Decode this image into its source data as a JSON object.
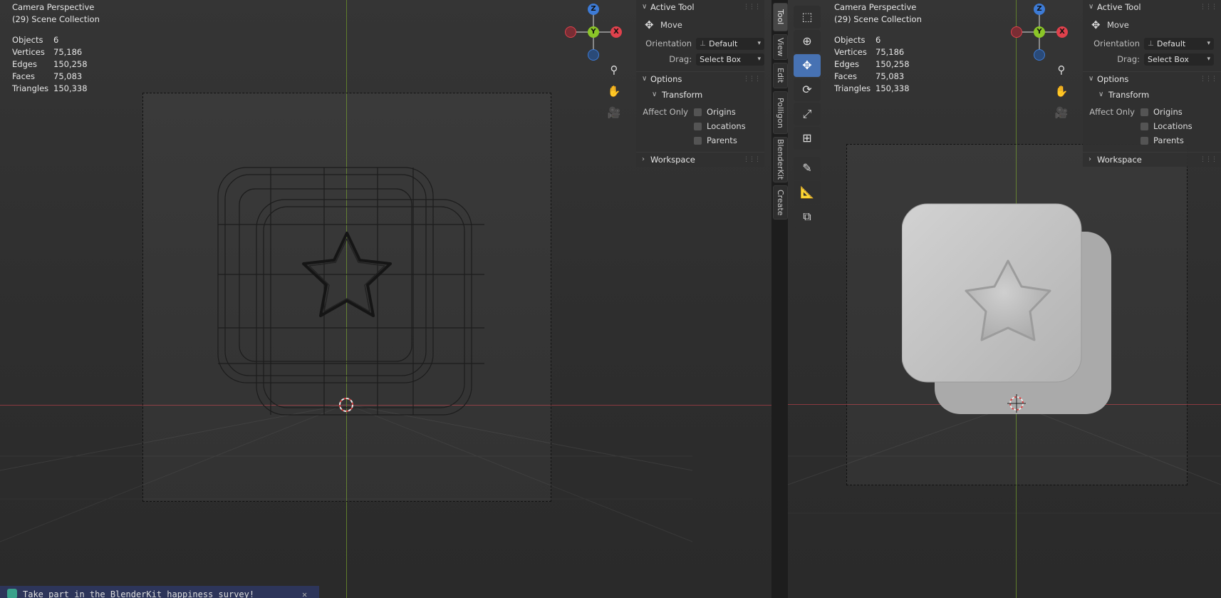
{
  "viewports": [
    {
      "id": "left",
      "mode": "wireframe",
      "info": {
        "line1": "Camera Perspective",
        "line2": "(29) Scene Collection"
      },
      "stats": [
        {
          "label": "Objects",
          "value": "6"
        },
        {
          "label": "Vertices",
          "value": "75,186"
        },
        {
          "label": "Edges",
          "value": "150,258"
        },
        {
          "label": "Faces",
          "value": "75,083"
        },
        {
          "label": "Triangles",
          "value": "150,338"
        }
      ]
    },
    {
      "id": "right",
      "mode": "solid",
      "info": {
        "line1": "Camera Perspective",
        "line2": "(29) Scene Collection"
      },
      "stats": [
        {
          "label": "Objects",
          "value": "6"
        },
        {
          "label": "Vertices",
          "value": "75,186"
        },
        {
          "label": "Edges",
          "value": "150,258"
        },
        {
          "label": "Faces",
          "value": "75,083"
        },
        {
          "label": "Triangles",
          "value": "150,338"
        }
      ]
    }
  ],
  "gizmo": {
    "z": "Z",
    "y": "Y",
    "x": "X",
    "colors": {
      "x": "#e0414c",
      "y": "#8bc628",
      "z": "#3d7bd6"
    }
  },
  "nav_buttons": [
    "zoom-icon",
    "hand-pan-icon",
    "camera-icon"
  ],
  "n_panel": {
    "active_tool_header": "Active Tool",
    "tool_name": "Move",
    "orientation_label": "Orientation",
    "orientation_value": "Default",
    "drag_label": "Drag:",
    "drag_value": "Select Box",
    "options_header": "Options",
    "transform_header": "Transform",
    "affect_only_label": "Affect Only",
    "checks": [
      "Origins",
      "Locations",
      "Parents"
    ],
    "workspace_header": "Workspace"
  },
  "side_tabs": [
    "Tool",
    "View",
    "Edit",
    "Polligon",
    "BlenderKit",
    "Create"
  ],
  "toolbar": [
    "select-box-icon",
    "cursor-icon",
    "move-icon",
    "rotate-icon",
    "scale-icon",
    "transform-icon",
    "annotate-icon",
    "measure-icon",
    "add-cube-icon"
  ],
  "toolbar_active": "move-icon",
  "banner": {
    "text": "Take part in the BlenderKit happiness survey!",
    "close": "✕"
  },
  "colors": {
    "accent": "#4772b3",
    "x_axis": "#8b3a40",
    "y_axis": "#5f7d2c"
  }
}
